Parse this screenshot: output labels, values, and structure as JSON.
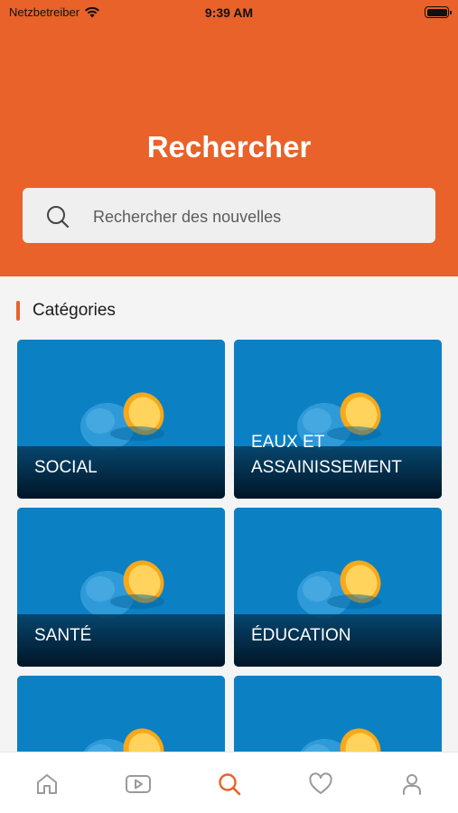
{
  "status_bar": {
    "carrier": "Netzbetreiber",
    "time": "9:39 AM"
  },
  "header": {
    "title": "Rechercher"
  },
  "search": {
    "placeholder": "Rechercher des nouvelles"
  },
  "categories": {
    "title": "Catégories",
    "items": [
      {
        "label": "SOCIAL"
      },
      {
        "label": "EAUX ET\nASSAINISSEMENT"
      },
      {
        "label": "SANTÉ"
      },
      {
        "label": "ÉDUCATION"
      },
      {
        "label": ""
      },
      {
        "label": ""
      }
    ]
  },
  "tabbar": {
    "active": "search",
    "tabs": [
      {
        "icon": "home-icon"
      },
      {
        "icon": "video-icon"
      },
      {
        "icon": "search-icon"
      },
      {
        "icon": "heart-icon"
      },
      {
        "icon": "profile-icon"
      }
    ]
  },
  "colors": {
    "accent": "#e8622a",
    "card_blue": "#0a7fc0",
    "inactive_icon": "#9a9a9a"
  }
}
